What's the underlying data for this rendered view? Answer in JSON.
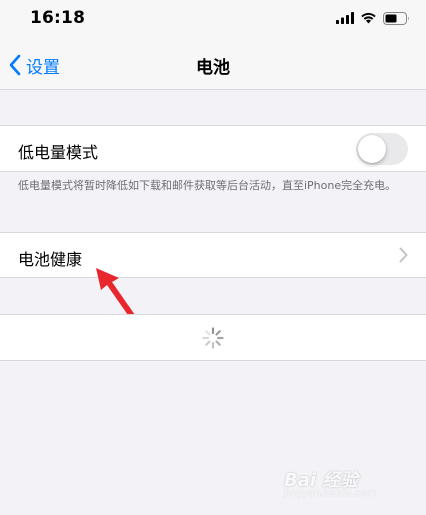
{
  "status_bar": {
    "time": "16:18"
  },
  "nav": {
    "back_label": "设置",
    "title": "电池"
  },
  "low_power": {
    "label": "低电量模式",
    "enabled": false,
    "footnote": "低电量模式将暂时降低如下载和邮件获取等后台活动，直至iPhone完全充电。"
  },
  "battery_health": {
    "label": "电池健康"
  },
  "watermark": {
    "text": "Bai 经验",
    "url": "jingyan.baidu.com"
  },
  "colors": {
    "accent": "#007aff",
    "background": "#f2f2f7",
    "annotation_arrow": "#e8262d",
    "toggle_off": "#e9e9eb"
  },
  "icons": [
    "signal-icon",
    "wifi-icon",
    "battery-icon",
    "back-chevron-icon",
    "chevron-right-icon",
    "loading-spinner-icon",
    "arrow-annotation"
  ]
}
